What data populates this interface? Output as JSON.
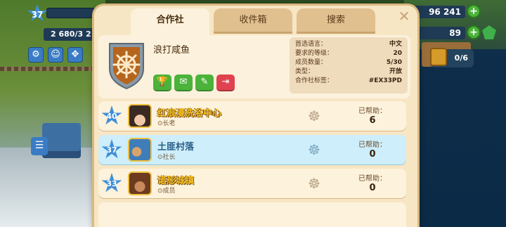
{
  "hud": {
    "level": "37",
    "population": "2 680/3 2",
    "coins": "96 241",
    "gems": "89",
    "chest": "0/6"
  },
  "tabs": [
    {
      "label": "合作社"
    },
    {
      "label": "收件箱"
    },
    {
      "label": "搜索"
    }
  ],
  "club": {
    "name": "浪打咸鱼",
    "info": [
      {
        "label": "首选语言：",
        "value": "中文"
      },
      {
        "label": "要求的等级：",
        "value": "20"
      },
      {
        "label": "成员数量：",
        "value": "5/30"
      },
      {
        "label": "类型：",
        "value": "开放"
      },
      {
        "label": "合作社标签：",
        "value": "#EX33PD"
      }
    ]
  },
  "members": [
    {
      "level": "40",
      "name": "红浪漫洗浴中心",
      "role": "⊙长老",
      "help_label": "已帮助：",
      "help_value": "6"
    },
    {
      "level": "37",
      "name": "土匪村落",
      "role": "⊙社长",
      "help_label": "已帮助：",
      "help_value": "0"
    },
    {
      "level": "33",
      "name": "诺彤城镇",
      "role": "⊙成员",
      "help_label": "已帮助：",
      "help_value": "0"
    }
  ],
  "colors": {
    "panel": "#f7e6c4",
    "selected_row": "#cdeefa",
    "action_green": "#4bb33a",
    "action_red": "#e0424f",
    "level_star": "#3f8fd8"
  }
}
